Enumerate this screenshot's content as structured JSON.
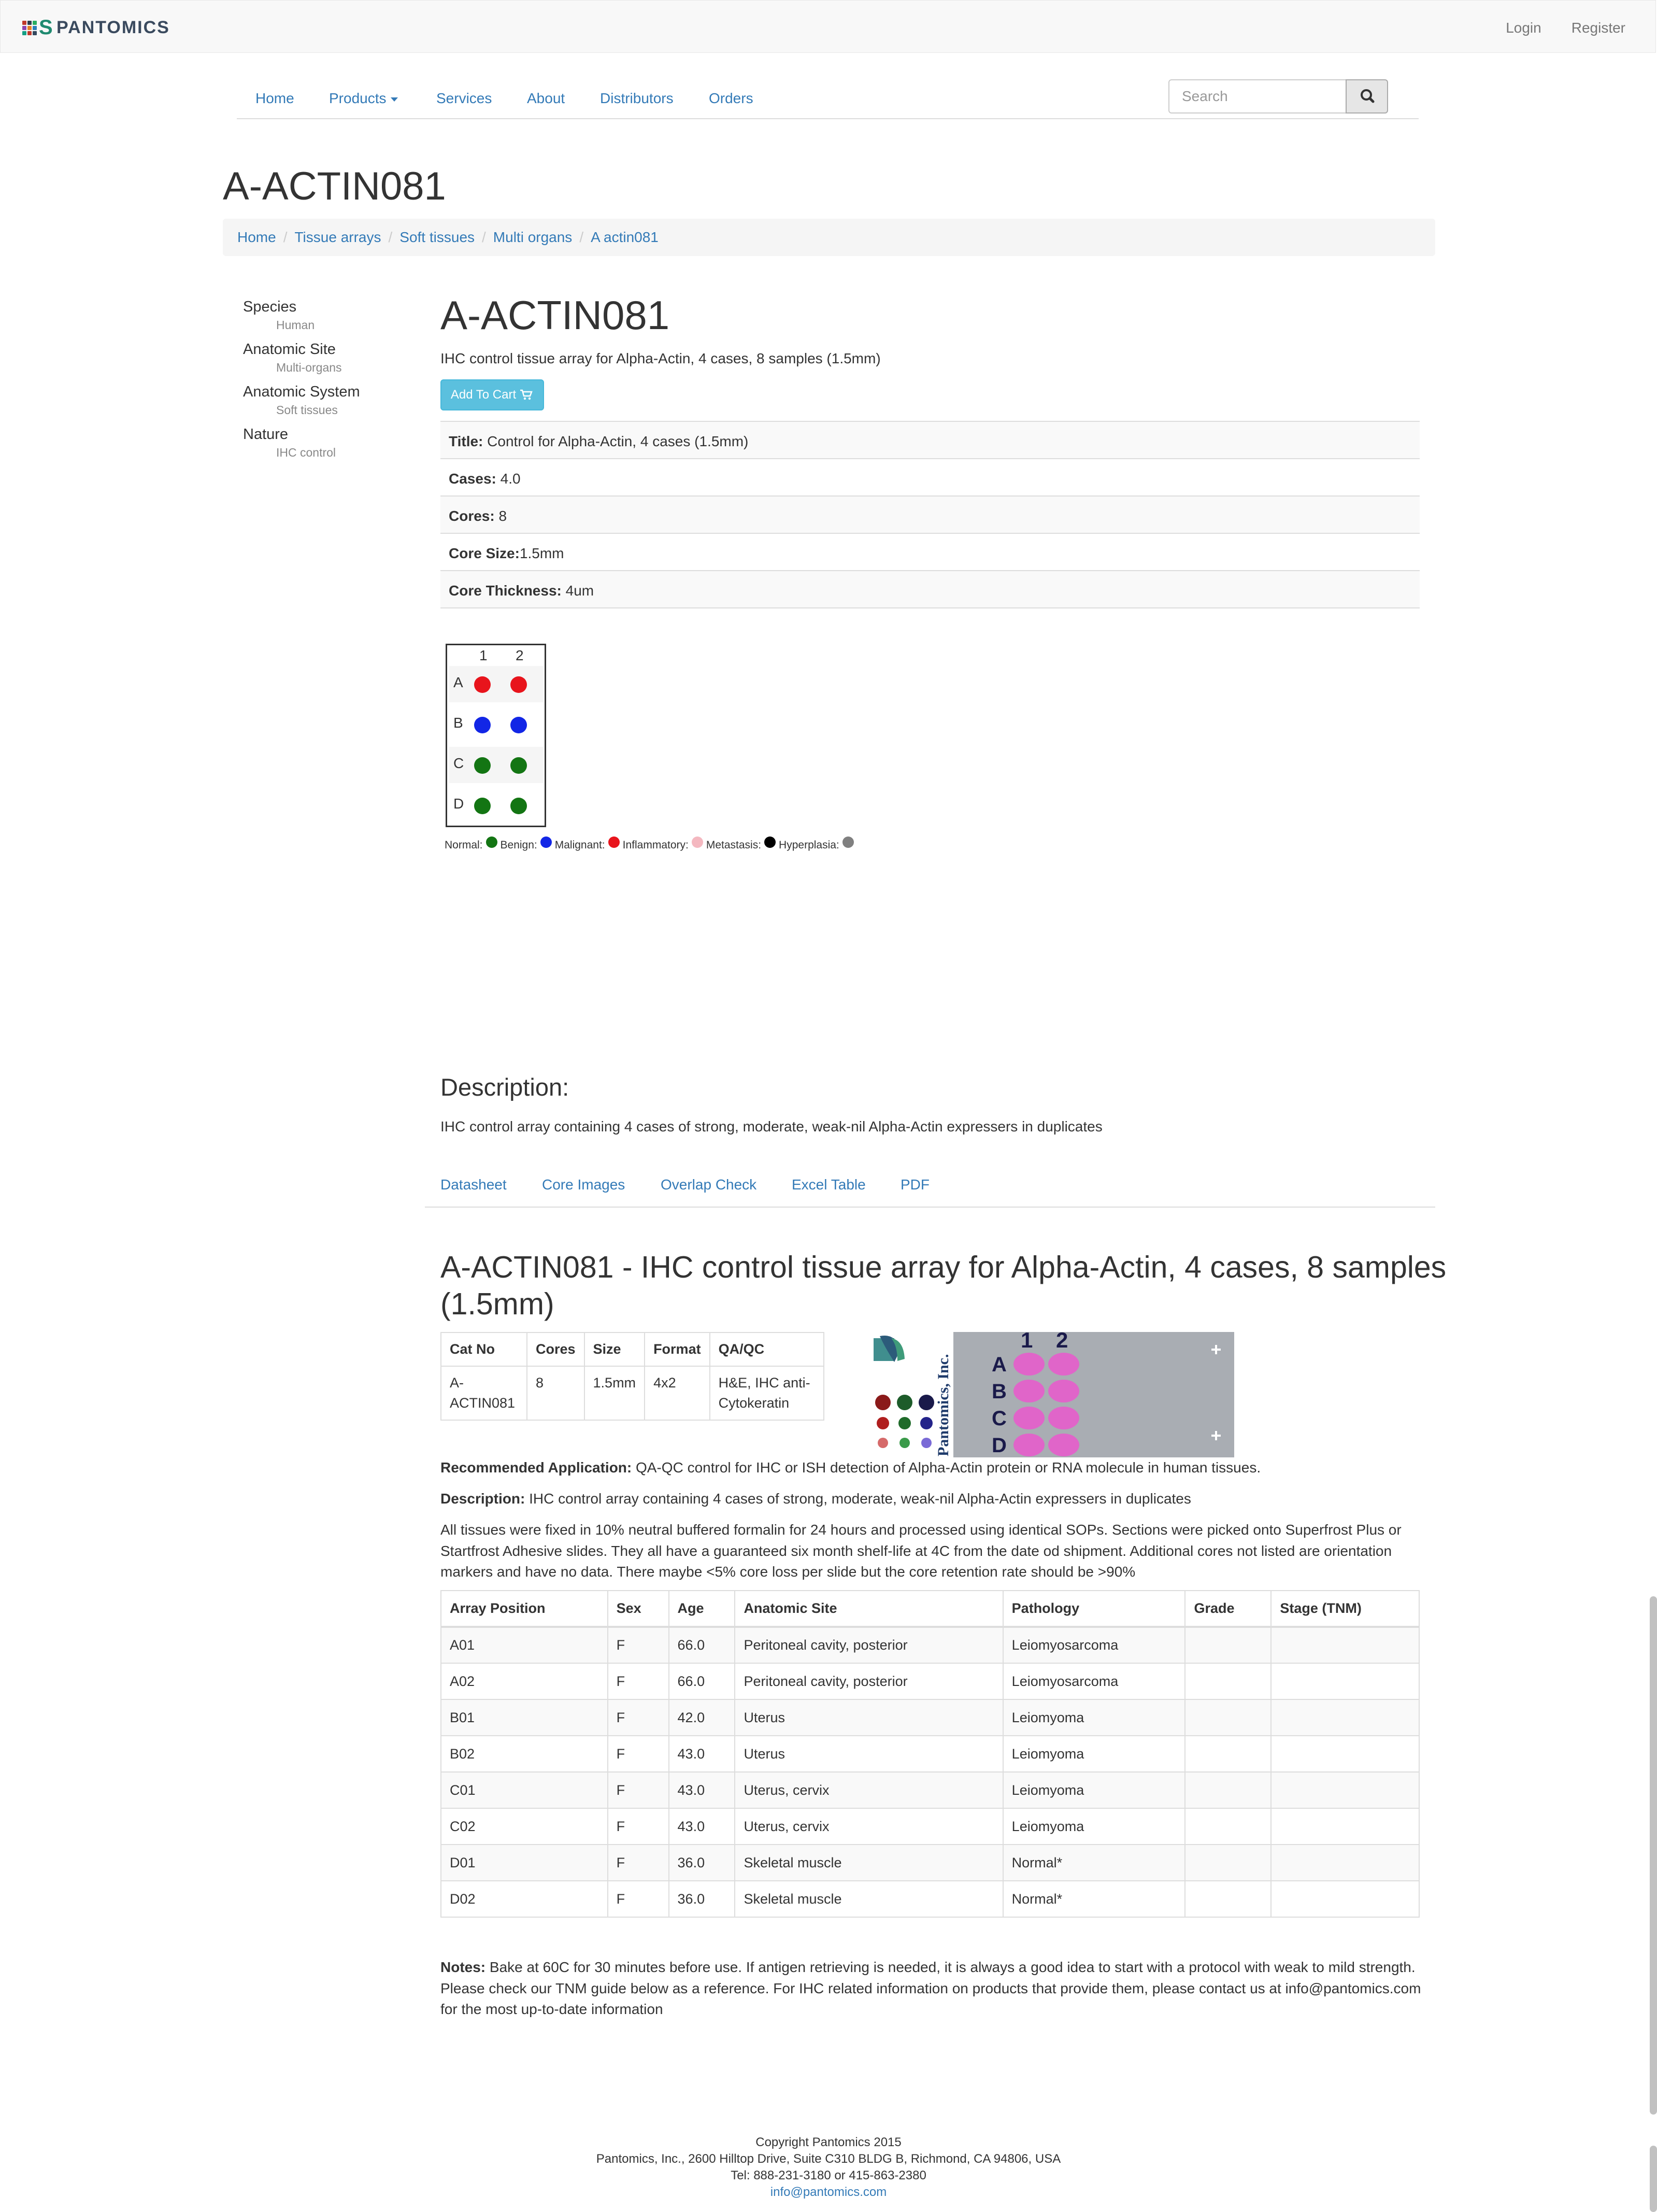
{
  "brand": {
    "name": "PANTOMICS"
  },
  "topnav": {
    "login": "Login",
    "register": "Register"
  },
  "mainnav": {
    "items": [
      "Home",
      "Products",
      "Services",
      "About",
      "Distributors",
      "Orders"
    ],
    "search_placeholder": "Search"
  },
  "page_title": "A-ACTIN081",
  "breadcrumb": [
    "Home",
    "Tissue arrays",
    "Soft tissues",
    "Multi organs",
    "A actin081"
  ],
  "sidebar": [
    {
      "key": "Species",
      "value": "Human"
    },
    {
      "key": "Anatomic Site",
      "value": "Multi-organs"
    },
    {
      "key": "Anatomic System",
      "value": "Soft tissues"
    },
    {
      "key": "Nature",
      "value": "IHC control"
    }
  ],
  "product": {
    "heading": "A-ACTIN081",
    "subtitle": "IHC control tissue array for Alpha-Actin, 4 cases, 8 samples (1.5mm)",
    "add_to_cart": "Add To Cart",
    "properties": [
      {
        "label": "Title:",
        "value": " Control for Alpha-Actin, 4 cases (1.5mm)"
      },
      {
        "label": "Cases:",
        "value": " 4.0"
      },
      {
        "label": "Cores:",
        "value": " 8"
      },
      {
        "label": "Core Size:",
        "value": "1.5mm"
      },
      {
        "label": "Core Thickness:",
        "value": " 4um"
      }
    ]
  },
  "slide_map": {
    "columns": [
      "1",
      "2"
    ],
    "rows": [
      "A",
      "B",
      "C",
      "D"
    ],
    "cores": [
      [
        "#e8141c",
        "#e8141c"
      ],
      [
        "#1226e6",
        "#1226e6"
      ],
      [
        "#137513",
        "#137513"
      ],
      [
        "#137513",
        "#137513"
      ]
    ]
  },
  "legend": [
    {
      "label": "Normal:",
      "color": "#137513"
    },
    {
      "label": "Benign:",
      "color": "#1226e6"
    },
    {
      "label": "Malignant:",
      "color": "#e8141c"
    },
    {
      "label": "Inflammatory:",
      "color": "#f4b8c0"
    },
    {
      "label": "Metastasis:",
      "color": "#000000"
    },
    {
      "label": "Hyperplasia:",
      "color": "#808080"
    }
  ],
  "description": {
    "heading": "Description:",
    "text": "IHC control array containing 4 cases of strong, moderate, weak-nil Alpha-Actin expressers in duplicates"
  },
  "tabs": [
    "Datasheet",
    "Core Images",
    "Overlap Check",
    "Excel Table",
    "PDF"
  ],
  "datasheet": {
    "heading": "A-ACTIN081 - IHC control tissue array for Alpha-Actin, 4 cases, 8 samples (1.5mm)",
    "spec_headers": [
      "Cat No",
      "Cores",
      "Size",
      "Format",
      "QA/QC"
    ],
    "spec_row": [
      "A-ACTIN081",
      "8",
      "1.5mm",
      "4x2",
      "H&E, IHC anti-Cytokeratin"
    ],
    "slide_image": {
      "brand": "Pantomics, Inc.",
      "columns": [
        "1",
        "2"
      ],
      "rows": [
        "A",
        "B",
        "C",
        "D"
      ]
    },
    "recommended_label": "Recommended Application:",
    "recommended_text": " QA-QC control for IHC or ISH detection of Alpha-Actin protein or RNA molecule in human tissues.",
    "description_label": "Description:",
    "description_text": " IHC control array containing 4 cases of strong, moderate, weak-nil Alpha-Actin expressers in duplicates",
    "tissues_text": "All tissues were fixed in 10% neutral buffered formalin for 24 hours and processed using identical SOPs. Sections were picked onto Superfrost Plus or Startfrost Adhesive slides. They all have a guaranteed six month shelf-life at 4C from the date od shipment. Additional cores not listed are orientation markers and have no data. There maybe <5% core loss per slide but the core retention rate should be >90%",
    "case_headers": [
      "Array Position",
      "Sex",
      "Age",
      "Anatomic Site",
      "Pathology",
      "Grade",
      "Stage (TNM)"
    ],
    "cases": [
      [
        "A01",
        "F",
        "66.0",
        "Peritoneal cavity, posterior",
        "Leiomyosarcoma",
        "",
        ""
      ],
      [
        "A02",
        "F",
        "66.0",
        "Peritoneal cavity, posterior",
        "Leiomyosarcoma",
        "",
        ""
      ],
      [
        "B01",
        "F",
        "42.0",
        "Uterus",
        "Leiomyoma",
        "",
        ""
      ],
      [
        "B02",
        "F",
        "43.0",
        "Uterus",
        "Leiomyoma",
        "",
        ""
      ],
      [
        "C01",
        "F",
        "43.0",
        "Uterus, cervix",
        "Leiomyoma",
        "",
        ""
      ],
      [
        "C02",
        "F",
        "43.0",
        "Uterus, cervix",
        "Leiomyoma",
        "",
        ""
      ],
      [
        "D01",
        "F",
        "36.0",
        "Skeletal muscle",
        "Normal*",
        "",
        ""
      ],
      [
        "D02",
        "F",
        "36.0",
        "Skeletal muscle",
        "Normal*",
        "",
        ""
      ]
    ],
    "notes_label": "Notes:",
    "notes_text": " Bake at 60C for 30 minutes before use. If antigen retrieving is needed, it is always a good idea to start with a protocol with weak to mild strength. Please check our TNM guide below as a reference. For IHC related information on products that provide them, please contact us at info@pantomics.com for the most up-to-date information"
  },
  "footer": {
    "copyright": "Copyright Pantomics 2015",
    "address": "Pantomics, Inc., 2600 Hilltop Drive, Suite C310 BLDG B, Richmond, CA 94806, USA",
    "tel": "Tel: 888-231-3180 or 415-863-2380",
    "email": "info@pantomics.com"
  }
}
